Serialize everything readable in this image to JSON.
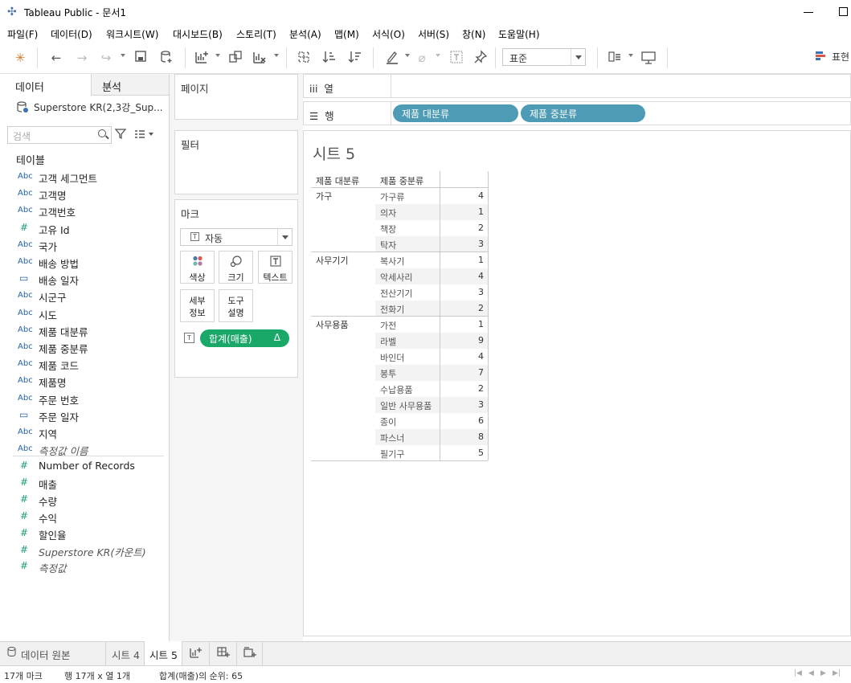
{
  "window": {
    "title": "Tableau Public - 문서1"
  },
  "menu": [
    "파일(F)",
    "데이터(D)",
    "워크시트(W)",
    "대시보드(B)",
    "스토리(T)",
    "분석(A)",
    "맵(M)",
    "서식(O)",
    "서버(S)",
    "창(N)",
    "도움말(H)"
  ],
  "toolbar": {
    "fit_value": "표준",
    "show_me": "표현"
  },
  "data_pane": {
    "tab_data": "데이터",
    "tab_analysis": "분석",
    "datasource": "Superstore KR(2,3강_Sup...",
    "search_placeholder": "검색",
    "tables_header": "테이블",
    "dimensions": [
      {
        "type": "Abc",
        "name": "고객 세그먼트"
      },
      {
        "type": "Abc",
        "name": "고객명"
      },
      {
        "type": "Abc",
        "name": "고객번호"
      },
      {
        "type": "#",
        "name": "고유 Id"
      },
      {
        "type": "Abc",
        "name": "국가"
      },
      {
        "type": "Abc",
        "name": "배송 방법"
      },
      {
        "type": "date",
        "name": "배송 일자"
      },
      {
        "type": "Abc",
        "name": "시군구"
      },
      {
        "type": "Abc",
        "name": "시도"
      },
      {
        "type": "Abc",
        "name": "제품 대분류"
      },
      {
        "type": "Abc",
        "name": "제품 중분류"
      },
      {
        "type": "Abc",
        "name": "제품 코드"
      },
      {
        "type": "Abc",
        "name": "제품명"
      },
      {
        "type": "Abc",
        "name": "주문 번호"
      },
      {
        "type": "date",
        "name": "주문 일자"
      },
      {
        "type": "Abc",
        "name": "지역"
      },
      {
        "type": "Abc",
        "name": "측정값 이름",
        "italic": true
      }
    ],
    "measures": [
      {
        "type": "#",
        "name": "Number of Records"
      },
      {
        "type": "#",
        "name": "매출"
      },
      {
        "type": "#",
        "name": "수량"
      },
      {
        "type": "#",
        "name": "수익"
      },
      {
        "type": "#",
        "name": "할인율"
      },
      {
        "type": "#",
        "name": "Superstore KR(카운트)",
        "italic": true
      },
      {
        "type": "#",
        "name": "측정값",
        "italic": true
      }
    ]
  },
  "cards": {
    "pages": "페이지",
    "filters": "필터",
    "marks": "마크",
    "mark_type": "자동",
    "mark_buttons": {
      "color": "색상",
      "size": "크기",
      "text": "텍스트",
      "detail": "세부\n정보",
      "tooltip": "도구\n설명"
    },
    "mark_pill": "합계(매출)",
    "mark_pill_delta": "Δ"
  },
  "shelves": {
    "columns_label": "열",
    "rows_label": "행",
    "rows_pills": [
      "제품 대분류",
      "제품 중분류"
    ]
  },
  "view": {
    "sheet_title": "시트 5",
    "headers": [
      "제품 대분류",
      "제품 중분류"
    ],
    "groups": [
      {
        "category": "가구",
        "rows": [
          {
            "sub": "가구류",
            "value": "4"
          },
          {
            "sub": "의자",
            "value": "1"
          },
          {
            "sub": "책장",
            "value": "2"
          },
          {
            "sub": "탁자",
            "value": "3"
          }
        ]
      },
      {
        "category": "사무기기",
        "rows": [
          {
            "sub": "복사기",
            "value": "1"
          },
          {
            "sub": "악세사리",
            "value": "4"
          },
          {
            "sub": "전산기기",
            "value": "3"
          },
          {
            "sub": "전화기",
            "value": "2"
          }
        ]
      },
      {
        "category": "사무용품",
        "rows": [
          {
            "sub": "가전",
            "value": "1"
          },
          {
            "sub": "라벨",
            "value": "9"
          },
          {
            "sub": "바인더",
            "value": "4"
          },
          {
            "sub": "봉투",
            "value": "7"
          },
          {
            "sub": "수납용품",
            "value": "2"
          },
          {
            "sub": "일반 사무용품",
            "value": "3"
          },
          {
            "sub": "종이",
            "value": "6"
          },
          {
            "sub": "파스너",
            "value": "8"
          },
          {
            "sub": "필기구",
            "value": "5"
          }
        ]
      }
    ]
  },
  "tabs": {
    "datasource": "데이터 원본",
    "sheets": [
      "시트 4",
      "시트 5"
    ],
    "active": "시트 5"
  },
  "status": {
    "marks": "17개 마크",
    "rows_cols": "행 17개  x  열 1개",
    "sum": "합계(매출)의 순위: 65"
  }
}
